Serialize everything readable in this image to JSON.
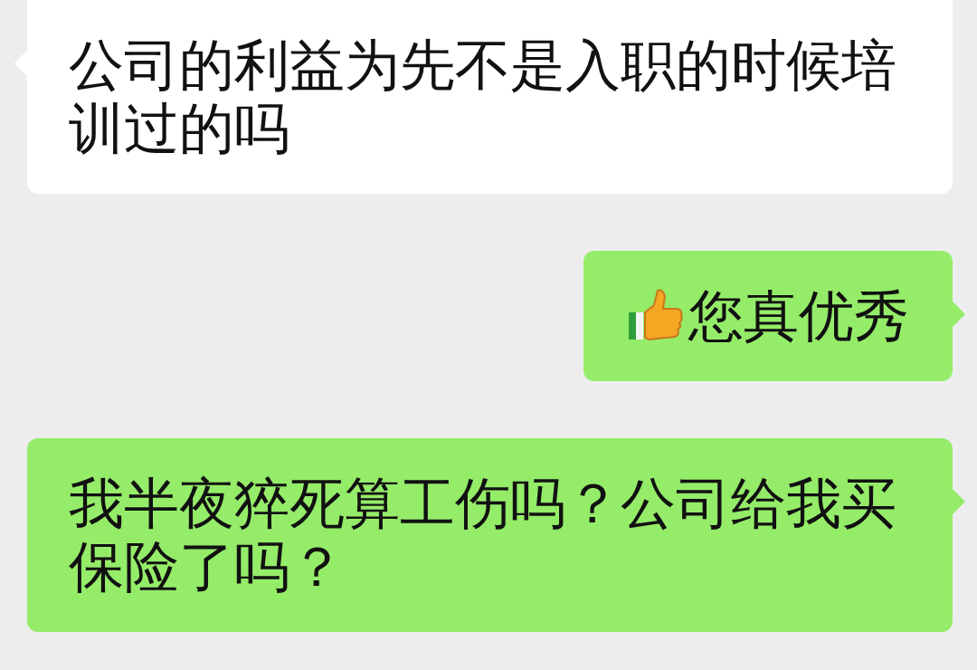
{
  "messages": [
    {
      "kind": "received",
      "has_emoji": false,
      "text": "公司的利益为先不是入职的时候培训过的吗"
    },
    {
      "kind": "sent",
      "has_emoji": true,
      "text": "您真优秀"
    },
    {
      "kind": "sent",
      "has_emoji": false,
      "text": "我半夜猝死算工伤吗？公司给我买保险了吗？"
    }
  ]
}
